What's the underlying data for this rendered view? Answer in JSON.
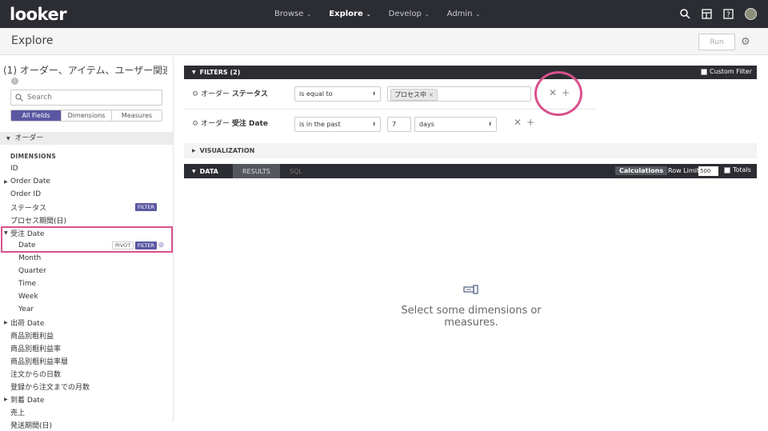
{
  "app": {
    "logo": "looker",
    "nav": [
      {
        "label": "Browse",
        "active": false
      },
      {
        "label": "Explore",
        "active": true
      },
      {
        "label": "Develop",
        "active": false
      },
      {
        "label": "Admin",
        "active": false
      }
    ],
    "nav_icons": [
      "search-icon",
      "dashboard-icon",
      "help-icon",
      "avatar"
    ]
  },
  "header": {
    "title": "Explore",
    "run_label": "Run"
  },
  "left": {
    "explore_title": "(1) オーダー、アイテム、ユーザー関連",
    "search_placeholder": "Search",
    "tabs": [
      {
        "label": "All Fields",
        "active": true
      },
      {
        "label": "Dimensions",
        "active": false
      },
      {
        "label": "Measures",
        "active": false
      }
    ],
    "view_name": "オーダー",
    "section_label": "DIMENSIONS",
    "filter_tag": "FILTER",
    "pivot_tag": "PIVOT",
    "fields": [
      {
        "label": "ID"
      },
      {
        "label": "Order Date"
      },
      {
        "label": "Order ID"
      },
      {
        "label": "ステータス"
      },
      {
        "label": "プロセス期間(日)"
      },
      {
        "label": "受注 Date"
      },
      {
        "label": "Date"
      },
      {
        "label": "Month"
      },
      {
        "label": "Quarter"
      },
      {
        "label": "Time"
      },
      {
        "label": "Week"
      },
      {
        "label": "Year"
      },
      {
        "label": "出荷 Date"
      },
      {
        "label": "商品別粗利益"
      },
      {
        "label": "商品別粗利益率"
      },
      {
        "label": "商品別粗利益率層"
      },
      {
        "label": "注文からの日数"
      },
      {
        "label": "登録から注文までの月数"
      },
      {
        "label": "到着 Date"
      },
      {
        "label": "売上"
      },
      {
        "label": "発送期間(日)"
      }
    ]
  },
  "filters": {
    "header": "FILTERS (2)",
    "custom_filter_label": "Custom Filter",
    "rows": [
      {
        "view": "オーダー",
        "field": "ステータス",
        "operator": "is equal to",
        "value_chip": "プロセス中"
      },
      {
        "view": "オーダー",
        "field": "受注 Date",
        "operator": "is in the past",
        "number": "7",
        "unit": "days"
      }
    ]
  },
  "visualization": {
    "header": "VISUALIZATION"
  },
  "data": {
    "tab_data": "DATA",
    "tab_results": "RESULTS",
    "tab_sql": "SQL",
    "calculations": "Calculations",
    "row_limit_label": "Row Limit",
    "row_limit_value": "500",
    "totals_label": "Totals",
    "empty_message": "Select some dimensions or measures."
  },
  "colors": {
    "nav_bg": "#2c2d33",
    "accent": "#5b58a2",
    "highlight": "#d9508c"
  }
}
